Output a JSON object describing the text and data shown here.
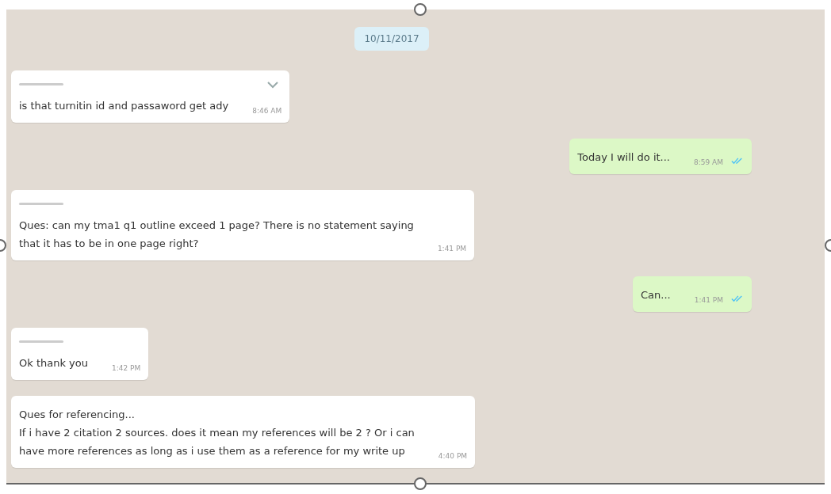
{
  "date_chip": "10/11/2017",
  "messages": [
    {
      "kind": "incoming",
      "sender_hidden": true,
      "menu_shown": true,
      "lines": [
        "is that turnitin id and passaword get ady"
      ],
      "time": "8:46 AM"
    },
    {
      "kind": "outgoing",
      "read": true,
      "lines": [
        "Today I will do it..."
      ],
      "time": "8:59 AM"
    },
    {
      "kind": "incoming",
      "sender_hidden": true,
      "menu_shown": false,
      "lines": [
        "Ques: can my tma1 q1 outline exceed 1 page? There is no statement saying",
        "that it has to be in one page right?"
      ],
      "time": "1:41 PM"
    },
    {
      "kind": "outgoing",
      "read": true,
      "lines": [
        "Can..."
      ],
      "time": "1:41 PM"
    },
    {
      "kind": "incoming",
      "sender_hidden": true,
      "menu_shown": false,
      "lines": [
        "Ok thank you"
      ],
      "time": "1:42 PM"
    },
    {
      "kind": "incoming",
      "sender_hidden": false,
      "menu_shown": false,
      "lines": [
        "Ques for referencing...",
        "If i have 2 citation 2 sources. does it mean my references will be 2 ? Or i can",
        "have more references as long as i use them as a reference for my write up"
      ],
      "time": "4:40 PM"
    }
  ]
}
